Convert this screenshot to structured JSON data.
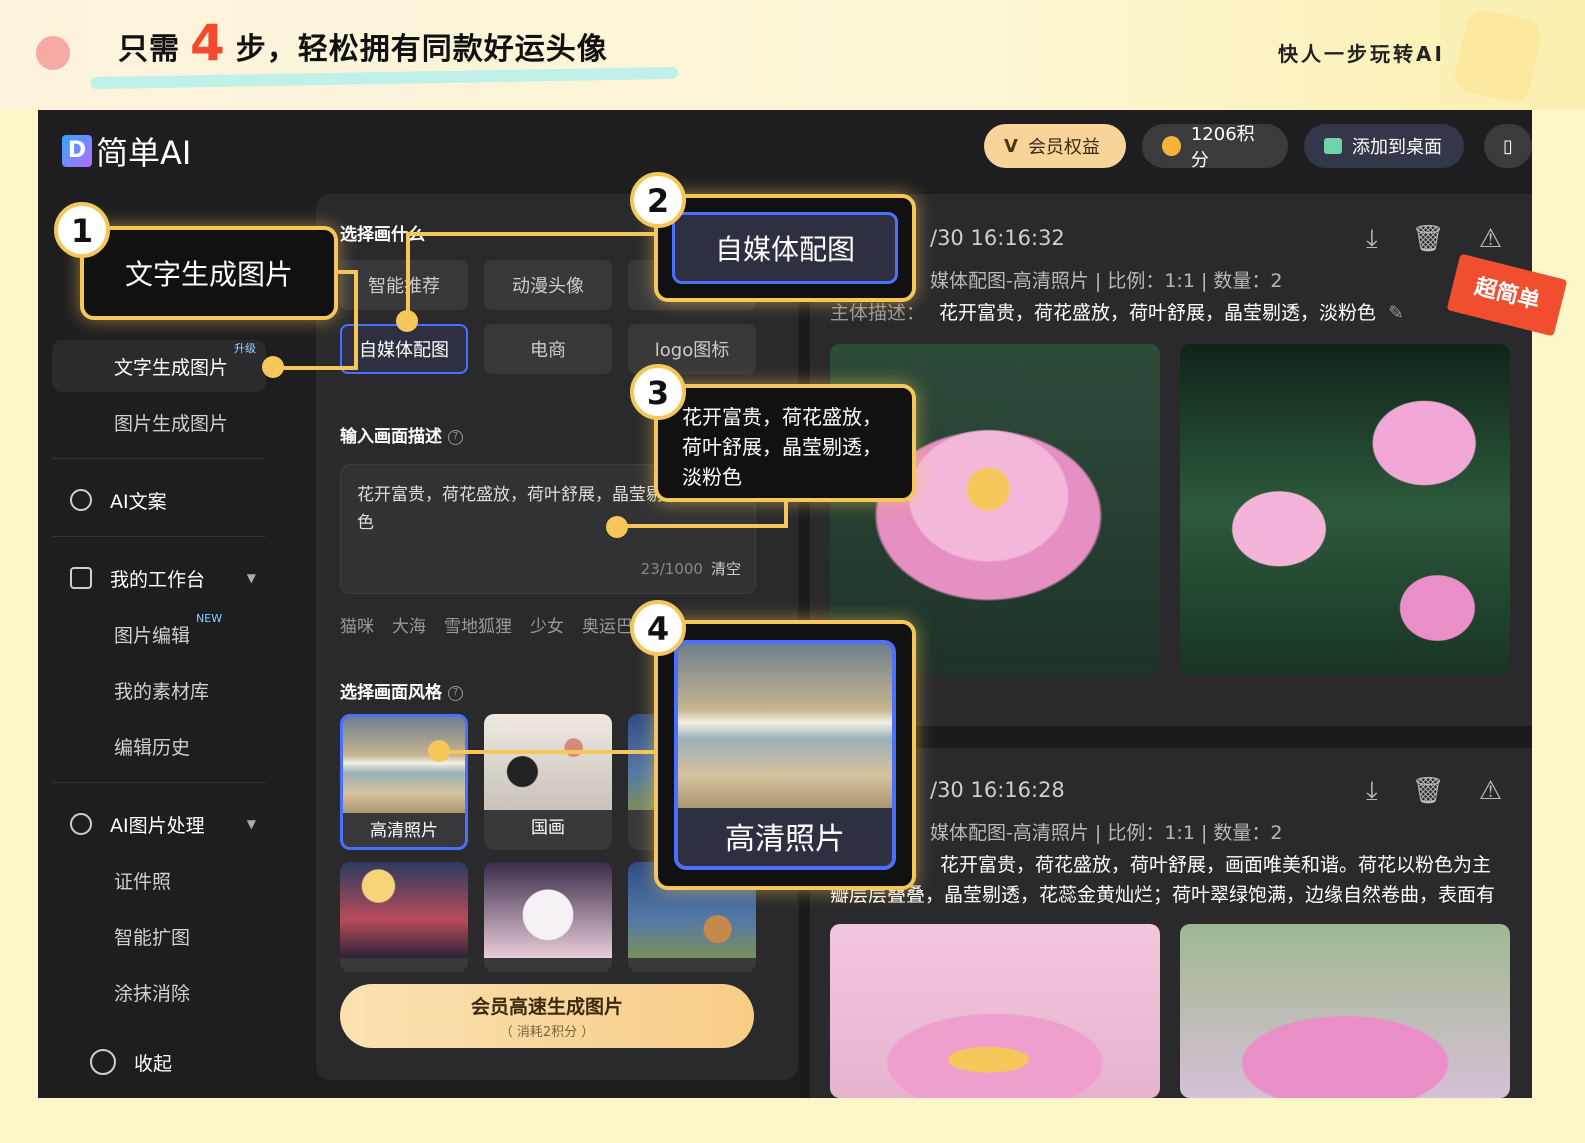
{
  "banner": {
    "title_pre": "只需",
    "title_num": "4",
    "title_post": "步，轻松拥有同款好运头像",
    "right": "快人一步玩转AI"
  },
  "app": {
    "logo": "简单AI",
    "logo_mark": "D",
    "topbar": {
      "vip": "会员权益",
      "points": "1206积分",
      "desktop": "添加到桌面"
    },
    "sidebar": {
      "text_to_image": "文字生成图片",
      "upgrade_tag": "升级",
      "image_to_image": "图片生成图片",
      "ai_copy": "AI文案",
      "workbench": "我的工作台",
      "image_edit": "图片编辑",
      "new_tag": "NEW",
      "assets": "我的素材库",
      "history": "编辑历史",
      "ai_image": "AI图片处理",
      "id_photo": "证件照",
      "expand": "智能扩图",
      "erase": "涂抹消除",
      "collapse": "收起"
    },
    "panel": {
      "choose_label": "选择画什么",
      "categories": [
        "智能推荐",
        "动漫头像",
        "自媒体配图",
        "电商",
        "logo图标"
      ],
      "desc_label": "输入画面描述",
      "desc_value": "花开富贵，荷花盛放，荷叶舒展，晶莹剔透，淡粉色",
      "counter": "23/1000",
      "clear": "清空",
      "chips": [
        "猫咪",
        "大海",
        "雪地狐狸",
        "少女",
        "奥运巴黎"
      ],
      "style_label": "选择画面风格",
      "styles": [
        "高清照片",
        "国画"
      ],
      "gen_main": "会员高速生成图片",
      "gen_sub": "（ 消耗2积分 ）"
    },
    "results": [
      {
        "date": "/30 16:16:32",
        "meta": "媒体配图-高清照片 | 比例：1:1 | 数量：2",
        "desc_key": "主体描述：",
        "desc": "花开富贵，荷花盛放，荷叶舒展，晶莹剔透，淡粉色"
      },
      {
        "date": "/30 16:16:28",
        "meta": "媒体配图-高清照片 | 比例：1:1 | 数量：2",
        "desc": "花开富贵，荷花盛放，荷叶舒展，画面唯美和谐。荷花以粉色为主",
        "desc2": "瓣层层叠叠，晶莹剔透，花蕊金黄灿烂；荷叶翠绿饱满，边缘自然卷曲，表面有"
      }
    ],
    "stamp": "超简单"
  },
  "callouts": {
    "step1": {
      "num": "1",
      "text": "文字生成图片"
    },
    "step2": {
      "num": "2",
      "text": "自媒体配图"
    },
    "step3": {
      "num": "3",
      "text": "花开富贵，荷花盛放，荷叶舒展，晶莹剔透，淡粉色"
    },
    "step4": {
      "num": "4",
      "text": "高清照片"
    }
  },
  "colors": {
    "accent": "#f5c65a",
    "select": "#4b6fff",
    "highlight": "#f14a2f"
  }
}
